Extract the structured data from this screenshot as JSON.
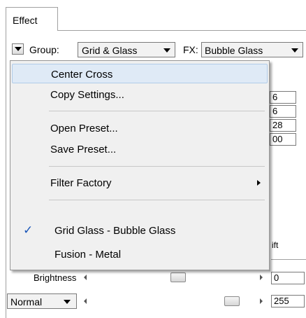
{
  "tabs": [
    {
      "label": "Effect"
    }
  ],
  "toolbar": {
    "group_label": "Group:",
    "group_value": "Grid & Glass",
    "fx_label": "FX:",
    "fx_value": "Bubble Glass"
  },
  "menu": {
    "items": [
      {
        "label": "Center Cross"
      },
      {
        "label": "Copy Settings..."
      },
      {
        "label": "Open Preset..."
      },
      {
        "label": "Save Preset..."
      },
      {
        "label": "Filter Factory"
      },
      {
        "label": "Grid  Glass - Bubble Glass"
      },
      {
        "label": "Fusion - Metal"
      }
    ],
    "check_glyph": "✓"
  },
  "side_fields": [
    "6",
    "6",
    "28",
    "00"
  ],
  "shift_label": "ift",
  "brightness": {
    "label": "Brightness",
    "value": "0"
  },
  "blend": {
    "mode": "Normal",
    "value": "255"
  },
  "colors": {
    "accent": "#1a56b8",
    "highlight": "#dfeaf6",
    "menu_bg": "#f0f0f0"
  },
  "icons": {
    "menu_toggle": "chevron-down-icon",
    "submenu": "chevron-right-icon",
    "checked": "check-icon"
  }
}
